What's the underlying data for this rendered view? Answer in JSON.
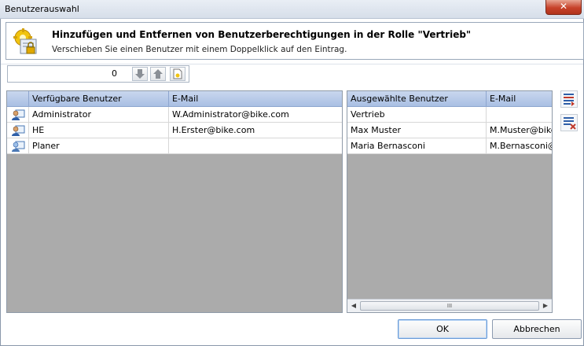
{
  "window": {
    "title": "Benutzerauswahl",
    "close_symbol": "✕"
  },
  "header": {
    "title": "Hinzufügen und Entfernen von Benutzerberechtigungen in der Rolle \"Vertrieb\"",
    "subtitle": "Verschieben Sie einen Benutzer mit einem Doppelklick auf den Eintrag."
  },
  "toolbar": {
    "value": "0"
  },
  "available": {
    "columns": [
      "Verfügbare Benutzer",
      "E-Mail"
    ],
    "rows": [
      {
        "name": "Administrator",
        "email": "W.Administrator@bike.com"
      },
      {
        "name": "HE",
        "email": "H.Erster@bike.com"
      },
      {
        "name": "Planer",
        "email": ""
      }
    ]
  },
  "selected": {
    "columns": [
      "Ausgewählte Benutzer",
      "E-Mail"
    ],
    "rows": [
      {
        "name": "Vertrieb",
        "email": ""
      },
      {
        "name": "Max Muster",
        "email": "M.Muster@bike"
      },
      {
        "name": "Maria Bernasconi",
        "email": "M.Bernasconi@"
      }
    ],
    "scroll_left": "◀",
    "scroll_right": "▶",
    "scroll_grip": "III"
  },
  "buttons": {
    "ok": "OK",
    "cancel": "Abbrechen"
  },
  "colors": {
    "header_grid": "#a9bfe3",
    "empty_grid": "#ababab",
    "close": "#c7422a"
  }
}
